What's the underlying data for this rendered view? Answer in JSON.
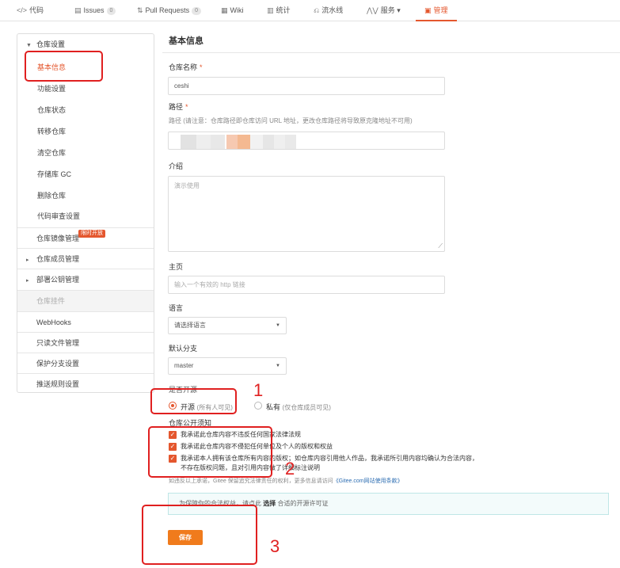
{
  "tabs": [
    {
      "icon": "</>",
      "label": "代码"
    },
    {
      "icon": "▤",
      "label": "Issues",
      "count": "0"
    },
    {
      "icon": "⇅",
      "label": "Pull Requests",
      "count": "0"
    },
    {
      "icon": "▦",
      "label": "Wiki"
    },
    {
      "icon": "▥",
      "label": "统计"
    },
    {
      "icon": "⎌",
      "label": "流水线"
    },
    {
      "icon": "⋀⋁",
      "label": "服务",
      "caret": "▾"
    },
    {
      "icon": "▣",
      "label": "管理"
    }
  ],
  "sidebar": {
    "group": "仓库设置",
    "sub_items": [
      "基本信息",
      "功能设置",
      "仓库状态",
      "转移仓库",
      "清空仓库",
      "存储库 GC",
      "删除仓库",
      "代码审查设置"
    ],
    "mirror": {
      "label": "仓库镜像管理",
      "badge": "限时开放"
    },
    "members": "仓库成员管理",
    "deploy_keys": "部署公钥管理",
    "plugins": "仓库挂件",
    "webhooks": "WebHooks",
    "readonly": "只读文件管理",
    "protect": "保护分支设置",
    "push_rules": "推送规则设置"
  },
  "main": {
    "title": "基本信息",
    "name_label": "仓库名称",
    "name_value": "ceshi",
    "path_label": "路径",
    "path_hint": "路径 (请注意：仓库路径即仓库访问 URL 地址，更改仓库路径将导致原克隆地址不可用)",
    "intro_label": "介绍",
    "intro_value": "演示使用",
    "homepage_label": "主页",
    "homepage_placeholder": "输入一个有效的 http 链接",
    "language_label": "语言",
    "language_value": "请选择语言",
    "branch_label": "默认分支",
    "branch_value": "master",
    "open_label": "是否开源",
    "open_option": "开源",
    "open_sub": "(所有人可见)",
    "private_option": "私有",
    "private_sub": "(仅仓库成员可见)",
    "notice_label": "仓库公开须知",
    "checks": [
      "我承诺此仓库内容不违反任何国家法律法规",
      "我承诺此仓库内容不侵犯任何单位及个人的版权和权益",
      "我承诺本人拥有该仓库所有内容的版权；如仓库内容引用他人作品，我承诺所引用内容均确认为合法内容，",
      "不存在版权问题，且对引用内容做了详细标注说明"
    ],
    "note_text": "如违反以上承诺，Gitee 保留追究法律责任的权利，更多信息请访问",
    "note_link": "《Gitee.com网站使用条款》",
    "info_prefix": "为保障你的合法权益，请点此",
    "info_bold": "选择",
    "info_suffix": "合适的开源许可证",
    "save_label": "保存"
  },
  "annotations": [
    "1",
    "2",
    "3"
  ],
  "colors": {
    "accent": "#e4572e",
    "annotation": "#e02020",
    "save": "#f07b1c"
  }
}
